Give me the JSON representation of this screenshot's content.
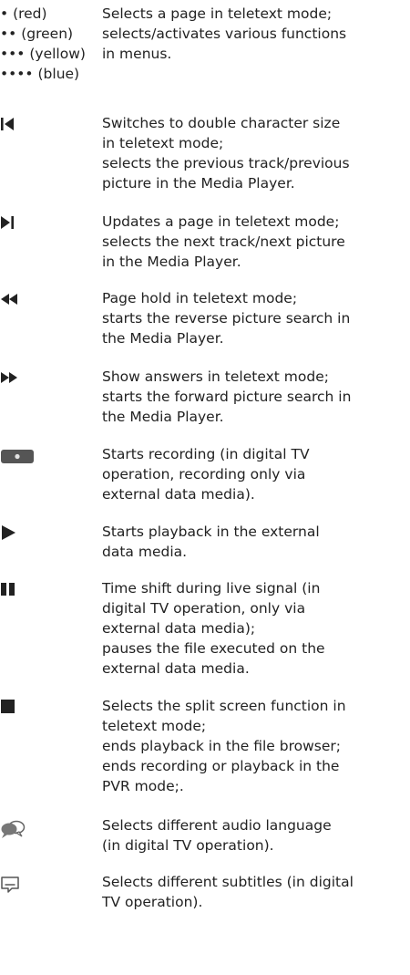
{
  "color_keys": {
    "labels": [
      "• (red)",
      "•• (green)",
      "••• (yellow)",
      "•••• (blue)"
    ],
    "lines": [
      "Selects a page in teletext mode;",
      "selects/activates various functions",
      "in menus."
    ]
  },
  "entries": [
    {
      "icon": "skip-previous-icon",
      "lines": [
        "Switches to double character size",
        "in teletext mode;",
        "selects the previous track/previous",
        "picture in the Media Player."
      ]
    },
    {
      "icon": "skip-next-icon",
      "lines": [
        "Updates a page in teletext mode;",
        "selects the next track/next picture",
        "in the Media Player."
      ]
    },
    {
      "icon": "rewind-icon",
      "lines": [
        "Page hold in teletext mode;",
        "starts the reverse picture search in",
        "the Media Player."
      ]
    },
    {
      "icon": "fast-forward-icon",
      "lines": [
        "Show answers in teletext mode;",
        "starts the forward picture search in",
        "the Media Player."
      ]
    },
    {
      "icon": "record-icon",
      "lines": [
        "Starts recording (in digital TV",
        "operation, recording only via",
        "external data media)."
      ]
    },
    {
      "icon": "play-icon",
      "lines": [
        "Starts playback in the external",
        "data media."
      ]
    },
    {
      "icon": "pause-icon",
      "lines": [
        "Time shift during live signal (in",
        "digital TV operation, only via",
        "external data media);",
        "pauses the file executed on the",
        "external data media."
      ]
    },
    {
      "icon": "stop-icon",
      "lines": [
        "Selects the split screen function in",
        "teletext mode;",
        "ends playback in the file browser;",
        "ends recording or playback in the",
        "PVR mode;."
      ]
    },
    {
      "icon": "audio-language-icon",
      "lines": [
        "Selects different audio language",
        "(in digital TV operation)."
      ]
    },
    {
      "icon": "subtitles-icon",
      "lines": [
        "Selects different subtitles (in digital",
        "TV operation)."
      ]
    }
  ]
}
